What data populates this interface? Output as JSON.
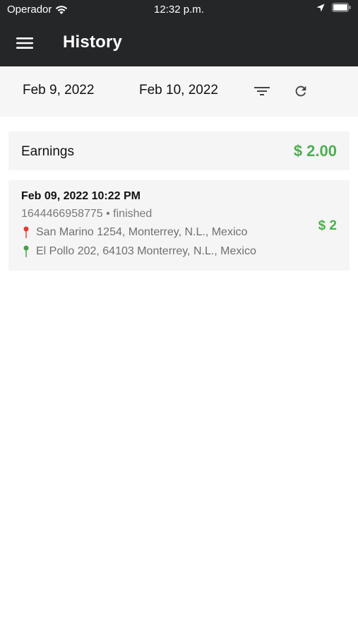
{
  "status_bar": {
    "carrier": "Operador",
    "time": "12:32 p.m."
  },
  "header": {
    "title": "History"
  },
  "filters": {
    "start_date": "Feb 9, 2022",
    "end_date": "Feb 10, 2022"
  },
  "earnings": {
    "label": "Earnings",
    "amount": "$ 2.00"
  },
  "trips": [
    {
      "datetime": "Feb 09, 2022 10:22 PM",
      "meta": "1644466958775 • finished",
      "pickup": "San Marino 1254, Monterrey, N.L., Mexico",
      "dropoff": "El Pollo 202, 64103 Monterrey, N.L., Mexico",
      "price": "$ 2"
    }
  ],
  "colors": {
    "appbar": "#252628",
    "accent_green": "#4caf50",
    "pickup_pin": "#e53935",
    "dropoff_pin": "#43a047"
  },
  "icons": {
    "menu": "hamburger-icon",
    "filter": "filter-lines-icon",
    "refresh": "refresh-icon",
    "pickup": "red-pin-icon",
    "dropoff": "green-pin-icon"
  }
}
